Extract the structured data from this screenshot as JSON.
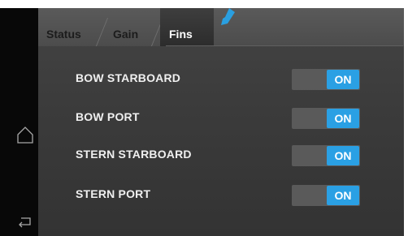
{
  "tabs": [
    {
      "label": "Status",
      "active": false
    },
    {
      "label": "Gain",
      "active": false
    },
    {
      "label": "Fins",
      "active": true
    }
  ],
  "fins": [
    {
      "label": "BOW STARBOARD",
      "state": "ON"
    },
    {
      "label": "BOW PORT",
      "state": "ON"
    },
    {
      "label": "STERN STARBOARD",
      "state": "ON"
    },
    {
      "label": "STERN PORT",
      "state": "ON"
    }
  ],
  "colors": {
    "toggle_on": "#2aa0e4",
    "pointer_arrow": "#2a9fe0",
    "background": "#3b3b3b"
  },
  "icons": {
    "nav_home": "home-icon",
    "nav_back": "back-icon",
    "indicator": "pointer-arrow-icon"
  }
}
